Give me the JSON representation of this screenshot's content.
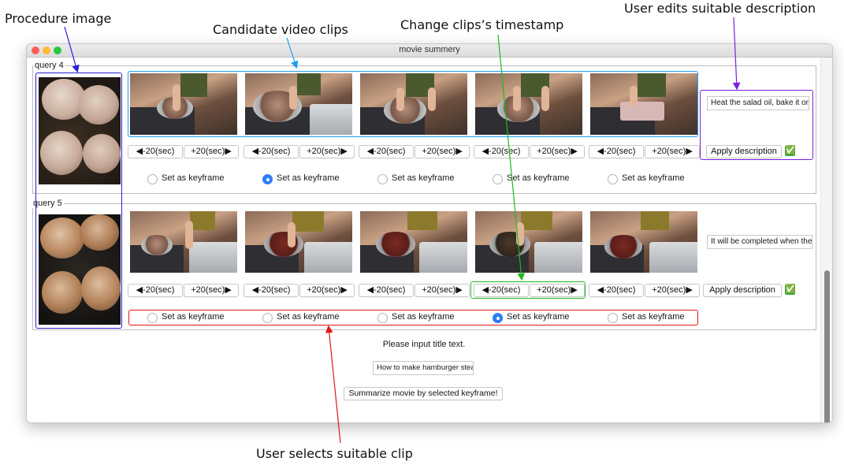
{
  "annotations": {
    "procedure_image": "Procedure image",
    "candidate_clips": "Candidate video clips",
    "change_timestamp": "Change clips’s timestamp",
    "user_edits": "User edits suitable description",
    "user_selects": "User selects suitable clip"
  },
  "window": {
    "title": "movie summery"
  },
  "queries": [
    {
      "label": "query 4",
      "minus_label": "◀-20(sec)",
      "plus_label": "+20(sec)▶",
      "radio_label": "Set as keyframe",
      "selected_index": 1,
      "description": "Heat the salad oil, bake it on",
      "apply_label": "Apply description",
      "applied": "✅"
    },
    {
      "label": "query 5",
      "minus_label": "◀-20(sec)",
      "plus_label": "+20(sec)▶",
      "radio_label": "Set as keyframe",
      "selected_index": 3,
      "description": "It will be completed when the",
      "apply_label": "Apply description",
      "applied": "✅"
    }
  ],
  "footer": {
    "prompt": "Please input title text.",
    "title_value": "How to make hamburger stea",
    "summarize_label": "Summarize movie by selected keyframe!"
  },
  "colors": {
    "procedure_box": "#2a1fd6",
    "clips_box": "#1c9ef0",
    "timestamp_box": "#1fb81f",
    "description_box": "#7a1fe0",
    "selection_box": "#e01616"
  }
}
